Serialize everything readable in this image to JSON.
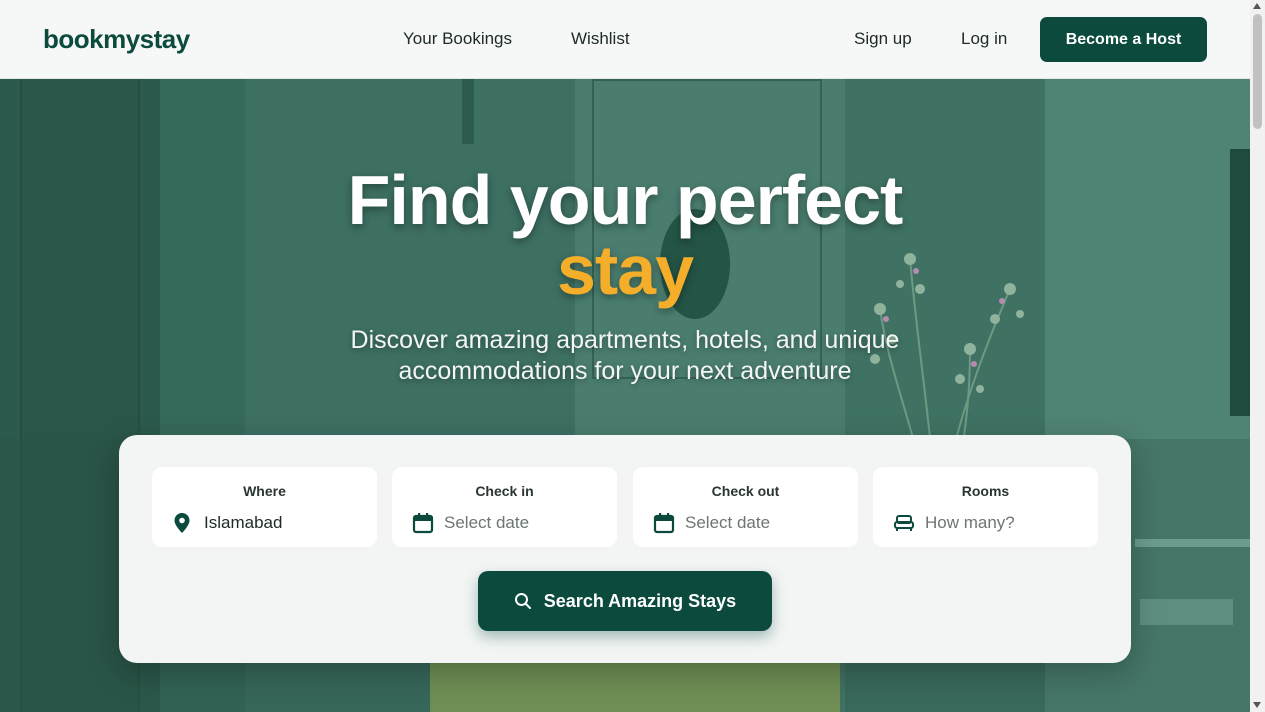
{
  "brand": {
    "name": "bookmystay"
  },
  "nav": {
    "links": [
      "Your Bookings",
      "Wishlist"
    ],
    "signup": "Sign up",
    "login": "Log in",
    "cta": "Become a Host"
  },
  "hero": {
    "title_line1": "Find your perfect",
    "title_line2": "stay",
    "subtitle_line1": "Discover amazing apartments, hotels, and unique",
    "subtitle_line2": "accommodations for your next adventure"
  },
  "search": {
    "where": {
      "label": "Where",
      "value": "Islamabad",
      "icon": "location-pin-icon"
    },
    "checkin": {
      "label": "Check in",
      "placeholder": "Select date",
      "icon": "calendar-icon"
    },
    "checkout": {
      "label": "Check out",
      "placeholder": "Select date",
      "icon": "calendar-icon"
    },
    "rooms": {
      "label": "Rooms",
      "placeholder": "How many?",
      "icon": "bed-icon"
    },
    "button": "Search Amazing Stays"
  },
  "colors": {
    "brand_green": "#0c4a3e",
    "accent_orange": "#f4ae2a"
  }
}
